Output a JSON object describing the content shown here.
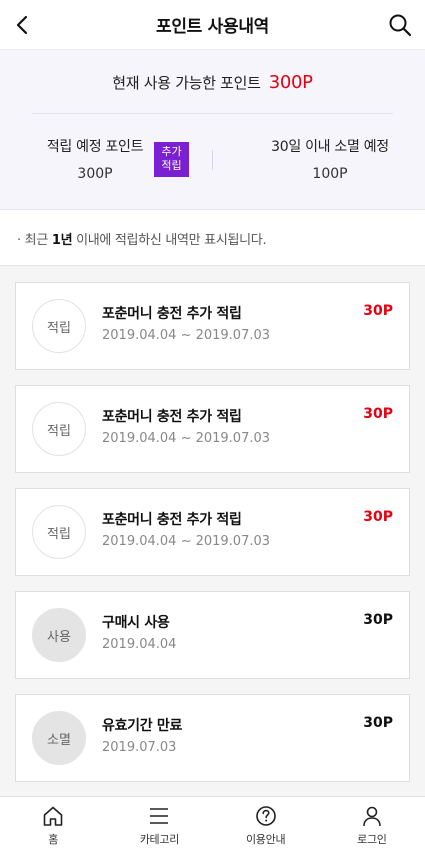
{
  "header": {
    "title": "포인트 사용내역",
    "back_icon": "chevron-left-icon",
    "search_icon": "search-icon"
  },
  "summary": {
    "available_label": "현재 사용 가능한 포인트",
    "available_value": "300P",
    "expected_label": "적립 예정 포인트",
    "expected_value": "300P",
    "expiring_label": "30일 이내 소멸 예정",
    "expiring_value": "100P",
    "badge_line1": "추가",
    "badge_line2": "적립"
  },
  "notice": {
    "prefix": "· 최근 ",
    "bold": "1년",
    "suffix": " 이내에 적립하신 내역만 표시됩니다."
  },
  "items": [
    {
      "type": "적립",
      "title": "포춘머니 충전 추가 적립",
      "date": "2019.04.04 ~ 2019.07.03",
      "points": "30P"
    },
    {
      "type": "적립",
      "title": "포춘머니 충전 추가 적립",
      "date": "2019.04.04 ~ 2019.07.03",
      "points": "30P"
    },
    {
      "type": "적립",
      "title": "포춘머니 충전 추가 적립",
      "date": "2019.04.04 ~ 2019.07.03",
      "points": "30P"
    },
    {
      "type": "사용",
      "title": "구매시 사용",
      "date": "2019.04.04",
      "points": "30P"
    },
    {
      "type": "소멸",
      "title": "유효기간 만료",
      "date": "2019.07.03",
      "points": "30P"
    }
  ],
  "colors": {
    "accent_red": "#e60012",
    "badge_purple": "#7a1fd1",
    "summary_bg": "#f6f5fb"
  },
  "bottom_nav": [
    {
      "label": "홈",
      "icon": "home-icon"
    },
    {
      "label": "카테고리",
      "icon": "menu-icon"
    },
    {
      "label": "이용안내",
      "icon": "help-icon"
    },
    {
      "label": "로그인",
      "icon": "user-icon"
    }
  ]
}
